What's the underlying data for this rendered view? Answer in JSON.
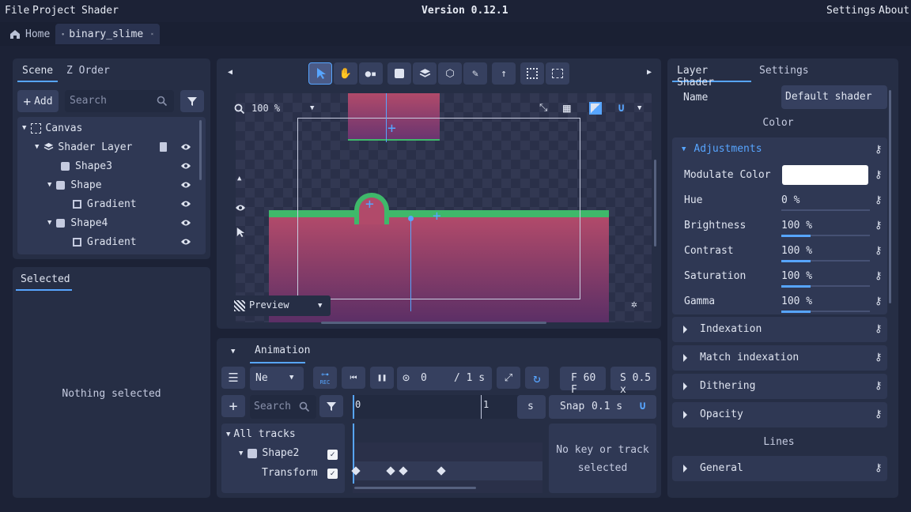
{
  "menu": {
    "file": "File",
    "project": "Project",
    "shader": "Shader",
    "version": "Version 0.12.1",
    "settings": "Settings",
    "about": "About"
  },
  "tabs": {
    "home": "Home",
    "doc": "binary_slime"
  },
  "scene": {
    "tab1": "Scene",
    "tab2": "Z Order",
    "add": "Add",
    "search_placeholder": "Search",
    "tree": [
      {
        "label": "Canvas"
      },
      {
        "label": "Shader Layer"
      },
      {
        "label": "Shape3"
      },
      {
        "label": "Shape"
      },
      {
        "label": "Gradient"
      },
      {
        "label": "Shape4"
      },
      {
        "label": "Gradient"
      }
    ]
  },
  "selected": {
    "tab": "Selected",
    "empty": "Nothing selected"
  },
  "viewport": {
    "zoom": "100 %",
    "preview": "Preview"
  },
  "animation": {
    "tab": "Animation",
    "mode": "Ne",
    "rec": "REC",
    "time": "0",
    "duration": "/ 1 s",
    "fps": "F 60 F",
    "speed": "S 0.5 x",
    "search_placeholder": "Search",
    "ruler0": "0",
    "ruler1": "1",
    "unit": "s",
    "snap": "Snap",
    "snap_val": "0.1 s",
    "all_tracks": "All tracks",
    "track1": "Shape2",
    "track2": "Transform",
    "no_key": "No key or track selected"
  },
  "inspector": {
    "tab1": "Layer Shader",
    "tab2": "Settings",
    "name_label": "Name",
    "name_value": "Default shader",
    "color_header": "Color",
    "adjustments": "Adjustments",
    "props": [
      {
        "label": "Modulate Color"
      },
      {
        "label": "Hue",
        "value": "0 %"
      },
      {
        "label": "Brightness",
        "value": "100 %"
      },
      {
        "label": "Contrast",
        "value": "100 %"
      },
      {
        "label": "Saturation",
        "value": "100 %"
      },
      {
        "label": "Gamma",
        "value": "100 %"
      }
    ],
    "sections": [
      "Indexation",
      "Match indexation",
      "Dithering",
      "Opacity"
    ],
    "lines_header": "Lines",
    "general": "General"
  },
  "colors": {
    "accent": "#57a5ff",
    "slime_green": "#3fb86a",
    "shape_top": "#b14a6a",
    "shape_bottom": "#5b2f66"
  }
}
